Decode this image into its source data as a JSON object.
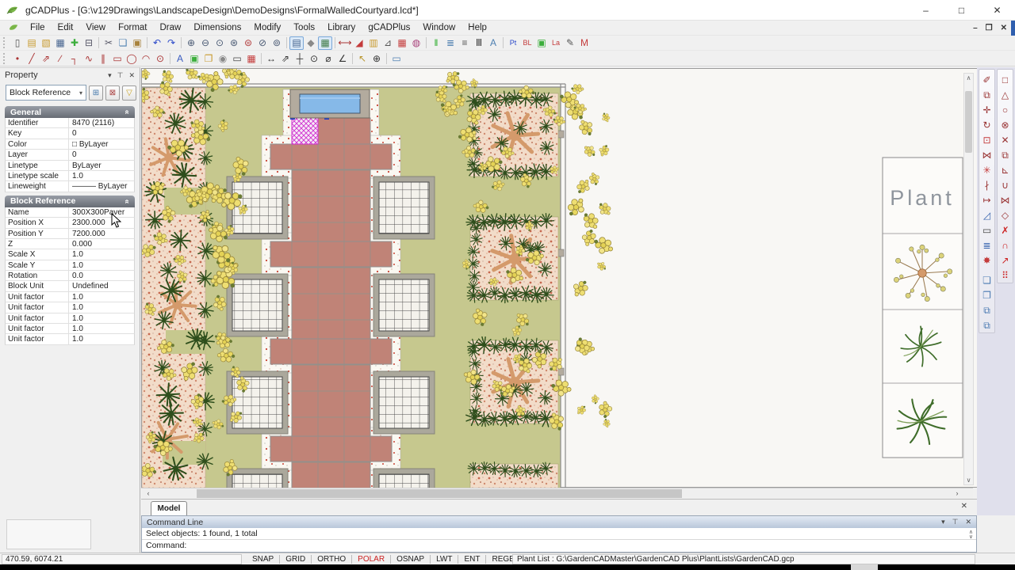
{
  "window": {
    "title": "gCADPlus - [G:\\v129Drawings\\LandscapeDesign\\DemoDesigns\\FormalWalledCourtyard.lcd*]",
    "minimize": "–",
    "maximize": "□",
    "close": "✕",
    "mdi_minimize": "–",
    "mdi_restore": "❐",
    "mdi_close": "✕"
  },
  "menu": {
    "items": [
      "File",
      "Edit",
      "View",
      "Format",
      "Draw",
      "Dimensions",
      "Modify",
      "Tools",
      "Library",
      "gCADPlus",
      "Window",
      "Help"
    ]
  },
  "toolbars": {
    "standard": [
      {
        "n": "new",
        "g": "▯",
        "c": "#555"
      },
      {
        "n": "open",
        "g": "▤",
        "c": "#c89a2e"
      },
      {
        "n": "open-sample",
        "g": "▧",
        "c": "#c89a2e"
      },
      {
        "n": "save",
        "g": "▦",
        "c": "#44628e"
      },
      {
        "n": "add-plant",
        "g": "✚",
        "c": "#3cae3c"
      },
      {
        "n": "print",
        "g": "⊟",
        "c": "#556"
      },
      {
        "sep": true
      },
      {
        "n": "cut",
        "g": "✂",
        "c": "#556"
      },
      {
        "n": "copy",
        "g": "❏",
        "c": "#4d7fb0"
      },
      {
        "n": "paste",
        "g": "▣",
        "c": "#a8823c"
      },
      {
        "sep": true
      },
      {
        "n": "undo",
        "g": "↶",
        "c": "#2b49c9"
      },
      {
        "n": "redo",
        "g": "↷",
        "c": "#2b49c9"
      },
      {
        "sep": true
      },
      {
        "n": "zoom-in",
        "g": "⊕",
        "c": "#4a5a74"
      },
      {
        "n": "zoom-out",
        "g": "⊖",
        "c": "#4a5a74"
      },
      {
        "n": "zoom-realtime",
        "g": "⊙",
        "c": "#4a5a74"
      },
      {
        "n": "zoom-dynamic",
        "g": "⊛",
        "c": "#4a5a74"
      },
      {
        "n": "zoom-extents",
        "g": "⊜",
        "c": "#b03838"
      },
      {
        "n": "zoom-window",
        "g": "⊘",
        "c": "#4a5a74"
      },
      {
        "n": "zoom-previous",
        "g": "⊚",
        "c": "#4a5a74"
      },
      {
        "sep": true
      },
      {
        "n": "properties-palette",
        "g": "▤",
        "c": "#44628e",
        "t": 1
      },
      {
        "n": "shade",
        "g": "◆",
        "c": "#8a8a8a"
      },
      {
        "n": "plant-palette",
        "g": "▦",
        "c": "#3f7a46",
        "t": 1
      },
      {
        "sep": true
      },
      {
        "n": "measure-distance",
        "g": "⟷",
        "c": "#aa3333"
      },
      {
        "n": "measure-area",
        "g": "◢",
        "c": "#c43b3b"
      },
      {
        "n": "plant-library",
        "g": "▥",
        "c": "#c89a2e"
      },
      {
        "n": "measure-angle",
        "g": "⊿",
        "c": "#555"
      },
      {
        "n": "plant-schedule",
        "g": "▦",
        "c": "#c43b3b"
      },
      {
        "n": "donut",
        "g": "◍",
        "c": "#a8407a"
      },
      {
        "sep": true
      },
      {
        "n": "color-control",
        "g": "‖",
        "c": "#22aa22"
      },
      {
        "n": "layer-control",
        "g": "≣",
        "c": "#4d7fb0"
      },
      {
        "n": "linetype-control",
        "g": "≡",
        "c": "#555"
      },
      {
        "n": "lineweight-control",
        "g": "Ⅲ",
        "c": "#333"
      },
      {
        "n": "text-style",
        "g": "A",
        "c": "#4d7fb0"
      },
      {
        "sep": true
      },
      {
        "n": "point-style",
        "g": "Pt",
        "c": "#2b49c9"
      },
      {
        "n": "block-manager",
        "g": "BL",
        "c": "#c43b3b"
      },
      {
        "n": "image-insert",
        "g": "▣",
        "c": "#3cae3c"
      },
      {
        "n": "layer-manager",
        "g": "La",
        "c": "#c43b3b"
      },
      {
        "n": "sketch",
        "g": "✎",
        "c": "#555"
      },
      {
        "n": "mtext",
        "g": "M",
        "c": "#c43b3b"
      }
    ],
    "draw": [
      {
        "n": "point",
        "g": "•",
        "c": "#aa3333"
      },
      {
        "n": "line",
        "g": "╱",
        "c": "#aa3333"
      },
      {
        "n": "ray",
        "g": "⇗",
        "c": "#aa3333"
      },
      {
        "n": "construction-line",
        "g": "∕",
        "c": "#aa3333"
      },
      {
        "n": "polyline",
        "g": "┐",
        "c": "#aa3333"
      },
      {
        "n": "spline",
        "g": "∿",
        "c": "#aa3333"
      },
      {
        "n": "offset",
        "g": "∥",
        "c": "#aa3333"
      },
      {
        "n": "rectangle",
        "g": "▭",
        "c": "#aa3333"
      },
      {
        "n": "circle",
        "g": "◯",
        "c": "#aa3333"
      },
      {
        "n": "arc",
        "g": "◠",
        "c": "#aa3333"
      },
      {
        "n": "ellipse",
        "g": "⊙",
        "c": "#aa3333"
      },
      {
        "sep": true
      },
      {
        "n": "text",
        "g": "A",
        "c": "#3a5cc0"
      },
      {
        "n": "insert-image",
        "g": "▣",
        "c": "#3cae3c"
      },
      {
        "n": "insert-block",
        "g": "❐",
        "c": "#c89a2e"
      },
      {
        "n": "render-sphere",
        "g": "◉",
        "c": "#888"
      },
      {
        "n": "boundary",
        "g": "▭",
        "c": "#444"
      },
      {
        "n": "hatch",
        "g": "▦",
        "c": "#c43b3b"
      },
      {
        "sep": true
      },
      {
        "n": "dim-linear",
        "g": "↔",
        "c": "#333"
      },
      {
        "n": "dim-aligned",
        "g": "⇗",
        "c": "#333"
      },
      {
        "n": "dim-ordinate",
        "g": "┼",
        "c": "#333"
      },
      {
        "n": "dim-radius",
        "g": "⊙",
        "c": "#333"
      },
      {
        "n": "dim-diameter",
        "g": "⌀",
        "c": "#333"
      },
      {
        "n": "dim-angular",
        "g": "∠",
        "c": "#333"
      },
      {
        "sep": true
      },
      {
        "n": "leader",
        "g": "↖",
        "c": "#b8962e"
      },
      {
        "n": "center-mark",
        "g": "⊕",
        "c": "#333"
      },
      {
        "sep": true
      },
      {
        "n": "command-line-toggle",
        "g": "▭",
        "c": "#4d7fb0"
      }
    ],
    "modify": [
      {
        "n": "format-painter",
        "g": "✐",
        "c": "#993333"
      },
      {
        "n": "copy-object",
        "g": "⧉",
        "c": "#993333"
      },
      {
        "n": "move",
        "g": "✛",
        "c": "#993333"
      },
      {
        "n": "rotate",
        "g": "↻",
        "c": "#993333"
      },
      {
        "n": "scale",
        "g": "⊡",
        "c": "#c43b3b"
      },
      {
        "n": "mirror",
        "g": "⋈",
        "c": "#993333"
      },
      {
        "n": "array",
        "g": "✳",
        "c": "#c43b3b"
      },
      {
        "n": "trim",
        "g": "∤",
        "c": "#993333"
      },
      {
        "n": "extend",
        "g": "↦",
        "c": "#993333"
      },
      {
        "n": "fillet",
        "g": "◿",
        "c": "#3a66b0"
      },
      {
        "n": "wipeout",
        "g": "▭",
        "c": "#444"
      },
      {
        "n": "layer-iso",
        "g": "≣",
        "c": "#3a66b0"
      },
      {
        "n": "explode",
        "g": "✸",
        "c": "#c43b3b"
      },
      {
        "gap": true
      },
      {
        "n": "bring-to-front",
        "g": "❏",
        "c": "#4a7ab2"
      },
      {
        "n": "send-to-back",
        "g": "❐",
        "c": "#4a7ab2"
      },
      {
        "n": "bring-above",
        "g": "⧉",
        "c": "#4a7ab2"
      },
      {
        "n": "send-under",
        "g": "⧉",
        "c": "#4a7ab2"
      }
    ],
    "osnap": [
      {
        "n": "snap-endpoint",
        "g": "□",
        "c": "#993333"
      },
      {
        "n": "snap-midpoint",
        "g": "△",
        "c": "#993333"
      },
      {
        "n": "snap-center",
        "g": "○",
        "c": "#993333"
      },
      {
        "n": "snap-node",
        "g": "⊗",
        "c": "#993333"
      },
      {
        "n": "snap-intersection",
        "g": "✕",
        "c": "#993333"
      },
      {
        "n": "snap-insertion",
        "g": "⧉",
        "c": "#993333"
      },
      {
        "n": "snap-perpendicular",
        "g": "⊾",
        "c": "#993333"
      },
      {
        "n": "snap-tangent",
        "g": "∪",
        "c": "#993333"
      },
      {
        "n": "snap-extension",
        "g": "⋈",
        "c": "#993333"
      },
      {
        "n": "snap-quadrant",
        "g": "◇",
        "c": "#993333"
      },
      {
        "n": "snap-none",
        "g": "✗",
        "c": "#cc2222"
      },
      {
        "n": "snap-settings",
        "g": "∩",
        "c": "#cc2222"
      },
      {
        "n": "snap-temporary",
        "g": "↗",
        "c": "#cc2222"
      },
      {
        "n": "snap-grid",
        "g": "⠿",
        "c": "#cc2222"
      }
    ]
  },
  "property_panel": {
    "title": "Property",
    "selector_value": "Block Reference",
    "header_icons": [
      "▾",
      "⊤",
      "✕"
    ],
    "tool_buttons": [
      {
        "n": "select-objects",
        "g": "⊞",
        "c": "#4477aa"
      },
      {
        "n": "deselect-objects",
        "g": "⊠",
        "c": "#aa4444"
      },
      {
        "n": "quick-filter",
        "g": "▽",
        "c": "#c8a020"
      }
    ],
    "sections": [
      {
        "title": "General",
        "rows": [
          {
            "label": "Identifier",
            "value": "8470 (2116)"
          },
          {
            "label": "Key",
            "value": "0"
          },
          {
            "label": "Color",
            "value": "□ ByLayer"
          },
          {
            "label": "Layer",
            "value": "0"
          },
          {
            "label": "Linetype",
            "value": "ByLayer"
          },
          {
            "label": "Linetype scale",
            "value": "1.0"
          },
          {
            "label": "Lineweight",
            "value": "——— ByLayer"
          }
        ]
      },
      {
        "title": "Block Reference",
        "rows": [
          {
            "label": "Name",
            "value": "300X300Paver"
          },
          {
            "label": "Position X",
            "value": "2300.000"
          },
          {
            "label": "Position Y",
            "value": "7200.000"
          },
          {
            "label": "Z",
            "value": "0.000"
          },
          {
            "label": "Scale X",
            "value": "1.0"
          },
          {
            "label": "Scale Y",
            "value": "1.0"
          },
          {
            "label": "Rotation",
            "value": "0.0"
          },
          {
            "label": "Block Unit",
            "value": "Undefined"
          },
          {
            "label": "Unit factor",
            "value": "1.0"
          },
          {
            "label": "Unit factor",
            "value": "1.0"
          },
          {
            "label": "Unit factor",
            "value": "1.0"
          },
          {
            "label": "Unit factor",
            "value": "1.0"
          },
          {
            "label": "Unit factor",
            "value": "1.0"
          }
        ]
      }
    ]
  },
  "canvas": {
    "plant_palette_title": "Plant",
    "model_tab": "Model",
    "tab_close": "✕"
  },
  "command_line": {
    "title": "Command Line",
    "header_icons": [
      "▾",
      "⊤",
      "✕"
    ],
    "line1": "Select objects: 1 found,  1 total",
    "line2": "Command:"
  },
  "status_bar": {
    "coordinates": "470.59,  6074.21",
    "toggles": [
      {
        "label": "SNAP",
        "active": false
      },
      {
        "label": "GRID",
        "active": false
      },
      {
        "label": "ORTHO",
        "active": false
      },
      {
        "label": "POLAR",
        "active": true
      },
      {
        "label": "OSNAP",
        "active": false
      },
      {
        "label": "LWT",
        "active": false
      },
      {
        "label": "ENT",
        "active": false
      },
      {
        "label": "REGEN",
        "active": false
      }
    ],
    "plant_list": "Plant List : G:\\GardenCADMaster\\GardenCAD Plus\\PlantLists\\GardenCAD.gcp"
  },
  "colors": {
    "accent_select": "#1a3acc",
    "selection_hatch": "#cf2fcf",
    "polar_active": "#cc2222",
    "lawn": "#c6c88e",
    "paver": "#c08377",
    "water": "#86b9e8"
  }
}
